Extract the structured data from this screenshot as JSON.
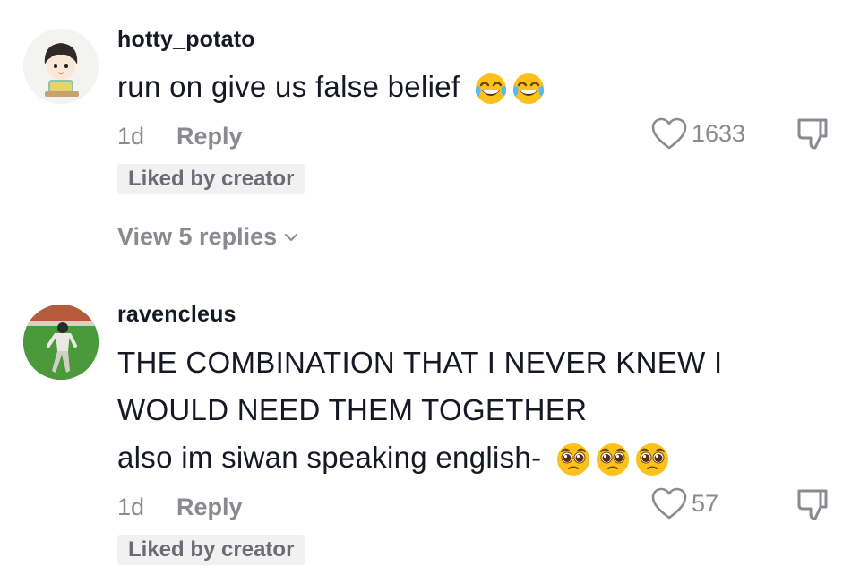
{
  "comments": [
    {
      "username": "hotty_potato",
      "lines": [
        "run on give us false belief"
      ],
      "emojis": [
        "joy-emoji",
        "joy-emoji"
      ],
      "time": "1d",
      "reply_label": "Reply",
      "likes": "1633",
      "liked_by_creator": "Liked by creator",
      "view_replies": "View 5 replies",
      "avatar": "cartoon-boy-avatar"
    },
    {
      "username": "ravencleus",
      "lines": [
        "THE COMBINATION THAT I NEVER KNEW I",
        "WOULD NEED THEM TOGETHER",
        "also im siwan speaking english-"
      ],
      "emojis": [
        "pleading-emoji",
        "pleading-emoji",
        "pleading-emoji"
      ],
      "time": "1d",
      "reply_label": "Reply",
      "likes": "57",
      "liked_by_creator": "Liked by creator",
      "avatar": "person-on-field-avatar"
    }
  ],
  "colors": {
    "text": "#161823",
    "muted": "#8a8b91",
    "badge_bg": "#f1f1f2"
  }
}
